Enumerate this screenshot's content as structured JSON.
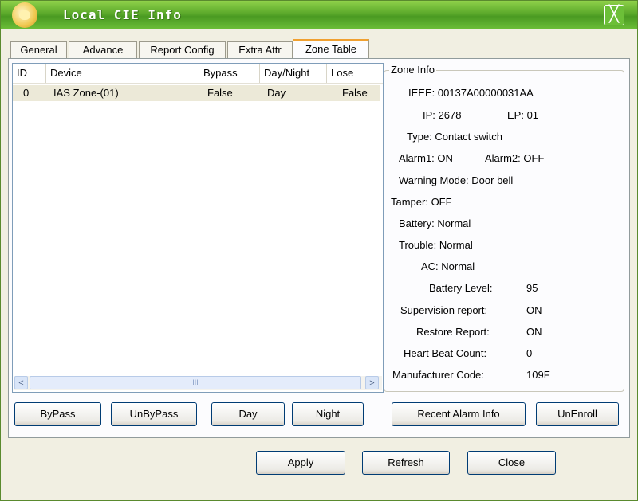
{
  "window": {
    "title": "Local CIE Info",
    "close_label": "╳"
  },
  "tabs": [
    "General",
    "Advance",
    "Report Config",
    "Extra Attr",
    "Zone Table"
  ],
  "zone_list": {
    "columns": [
      "ID",
      "Device",
      "Bypass",
      "Day/Night",
      "Lose"
    ],
    "rows": [
      {
        "id": "0",
        "device": "IAS Zone-(01)",
        "bypass": "False",
        "day_night": "Day",
        "lose": "False"
      }
    ],
    "scroll_left": "<",
    "scroll_right": ">",
    "scroll_grip": "III"
  },
  "zone_info": {
    "title": "Zone Info",
    "ieee": "IEEE:  00137A00000031AA",
    "ip": "IP:  2678",
    "ep": "EP:  01",
    "type": "Type:  Contact switch",
    "alarm1": "Alarm1:  ON",
    "alarm2": "Alarm2:  OFF",
    "warning_mode": "Warning Mode:  Door bell",
    "tamper": "Tamper:  OFF",
    "battery": "Battery:  Normal",
    "trouble": "Trouble:  Normal",
    "ac": "AC:  Normal",
    "battery_level_label": "Battery Level:",
    "battery_level_value": "95",
    "supervision_label": "Supervision report:",
    "supervision_value": "ON",
    "restore_label": "Restore Report:",
    "restore_value": "ON",
    "heartbeat_label": "Heart Beat Count:",
    "heartbeat_value": "0",
    "manufacturer_label": "Manufacturer Code:",
    "manufacturer_value": "109F"
  },
  "action_buttons": {
    "bypass": "ByPass",
    "unbypass": "UnByPass",
    "day": "Day",
    "night": "Night",
    "recent_alarm": "Recent Alarm Info",
    "unenroll": "UnEnroll"
  },
  "footer_buttons": {
    "apply": "Apply",
    "refresh": "Refresh",
    "close": "Close"
  },
  "colors": {
    "titlebar": "#5aa82a",
    "selected_row": "#ece9d8",
    "active_tab_accent": "#f0a030"
  }
}
